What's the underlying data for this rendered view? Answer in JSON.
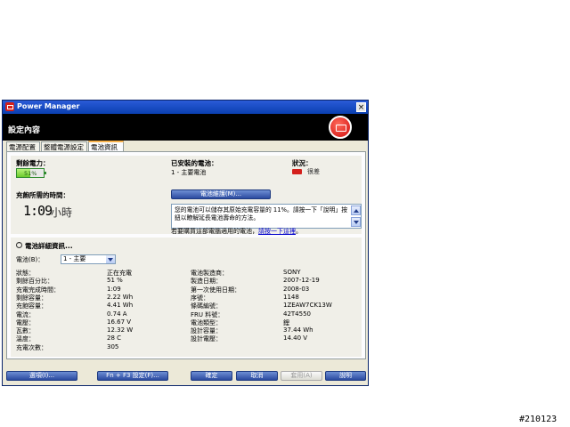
{
  "window": {
    "title": "Power Manager",
    "header_title": "設定內容"
  },
  "tabs": [
    {
      "label": "電源配置"
    },
    {
      "label": "整體電源設定"
    },
    {
      "label": "電池資訊"
    }
  ],
  "remaining": {
    "label": "剩餘電力：",
    "percent_text": "51%",
    "percent_value": 51
  },
  "charge_time": {
    "label": "充飽所需的時間：",
    "time": "1:09",
    "unit": "小時"
  },
  "installed": {
    "label": "已安裝的電池：",
    "value": "1 - 主要電池"
  },
  "status": {
    "label": "狀況：",
    "value": "很差"
  },
  "maintenance_button": "電池維護(M)...",
  "message": "您的電池可以儲存其原始充電容量的 11%。請按一下「說明」按鈕以瞭解延長電池壽命的方法。",
  "order_link": {
    "prefix": "若要購買這部電腦適用的電池，",
    "link": "請按一下這裡",
    "suffix": "。"
  },
  "details": {
    "header": "電池詳細資訊...",
    "battery_label": "電池(B)：",
    "battery_selected": "1 - 主要",
    "left_rows": [
      {
        "label": "狀態：",
        "value": "正在充電"
      },
      {
        "label": "剩餘百分比：",
        "value": "51 %"
      },
      {
        "label": "充電完成時間：",
        "value": "1:09"
      },
      {
        "label": "剩餘容量：",
        "value": "2.22 Wh"
      },
      {
        "label": "充飽容量：",
        "value": "4.41 Wh"
      },
      {
        "label": "電流：",
        "value": "0.74 A"
      },
      {
        "label": "電壓：",
        "value": "16.67 V"
      },
      {
        "label": "瓦數：",
        "value": "12.32 W"
      },
      {
        "label": "溫度：",
        "value": "28 C"
      },
      {
        "label": "充電次數：",
        "value": "305"
      }
    ],
    "right_rows": [
      {
        "label": "電池製造商：",
        "value": "SONY"
      },
      {
        "label": "製造日期：",
        "value": "2007-12-19"
      },
      {
        "label": "第一次使用日期：",
        "value": "2008-03"
      },
      {
        "label": "序號：",
        "value": "1148"
      },
      {
        "label": "條碼編號：",
        "value": "1ZEAW7CK13W"
      },
      {
        "label": "FRU 料號：",
        "value": "42T4550"
      },
      {
        "label": "電池類型：",
        "value": "鋰"
      },
      {
        "label": "設計容量：",
        "value": "37.44 Wh"
      },
      {
        "label": "設計電壓：",
        "value": "14.40 V"
      }
    ]
  },
  "bottom_buttons": {
    "options": "選項(I)...",
    "fn_f3": "Fn + F3 設定(F)...",
    "ok": "確定",
    "cancel": "取消",
    "apply": "套用(A)",
    "help": "說明"
  },
  "watermark": "#210123",
  "colors": {
    "titlebar": "#0a3fb0",
    "battery_fill": "#6ccc2c",
    "status_bad": "#d4201c"
  }
}
